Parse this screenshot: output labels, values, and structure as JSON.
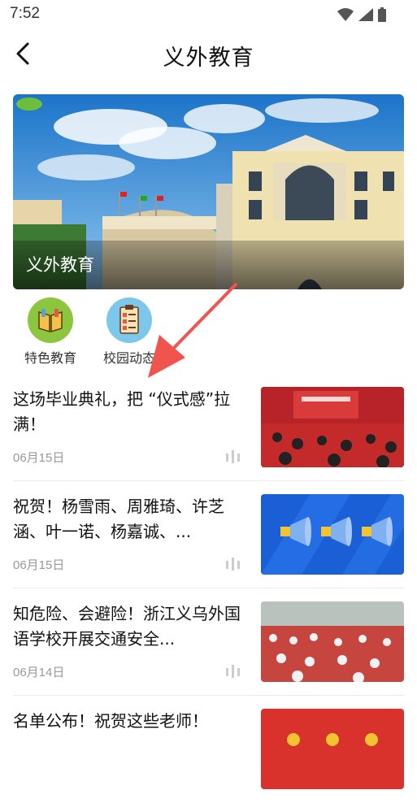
{
  "status_bar": {
    "time": "7:52"
  },
  "header": {
    "title": "义外教育"
  },
  "banner": {
    "caption": "义外教育"
  },
  "quick_entries": [
    {
      "label": "特色教育",
      "icon": "book-icon",
      "color": "#8cc63f"
    },
    {
      "label": "校园动态",
      "icon": "clipboard-icon",
      "color": "#7cc8ec"
    }
  ],
  "news": [
    {
      "title": "这场毕业典礼，把 “仪式感”拉满！",
      "date": "06月15日",
      "thumb": "graduation-ceremony-photo"
    },
    {
      "title": "祝贺！杨雪雨、周雅琦、许芝涵、叶一诺、杨嘉诚、...",
      "date": "06月15日",
      "thumb": "megaphone-graphic"
    },
    {
      "title": "知危险、会避险！浙江义乌外国语学校开展交通安全...",
      "date": "06月14日",
      "thumb": "students-auditorium-photo"
    },
    {
      "title": "名单公布！祝贺这些老师！",
      "date": "",
      "thumb": "red-graphic"
    }
  ]
}
